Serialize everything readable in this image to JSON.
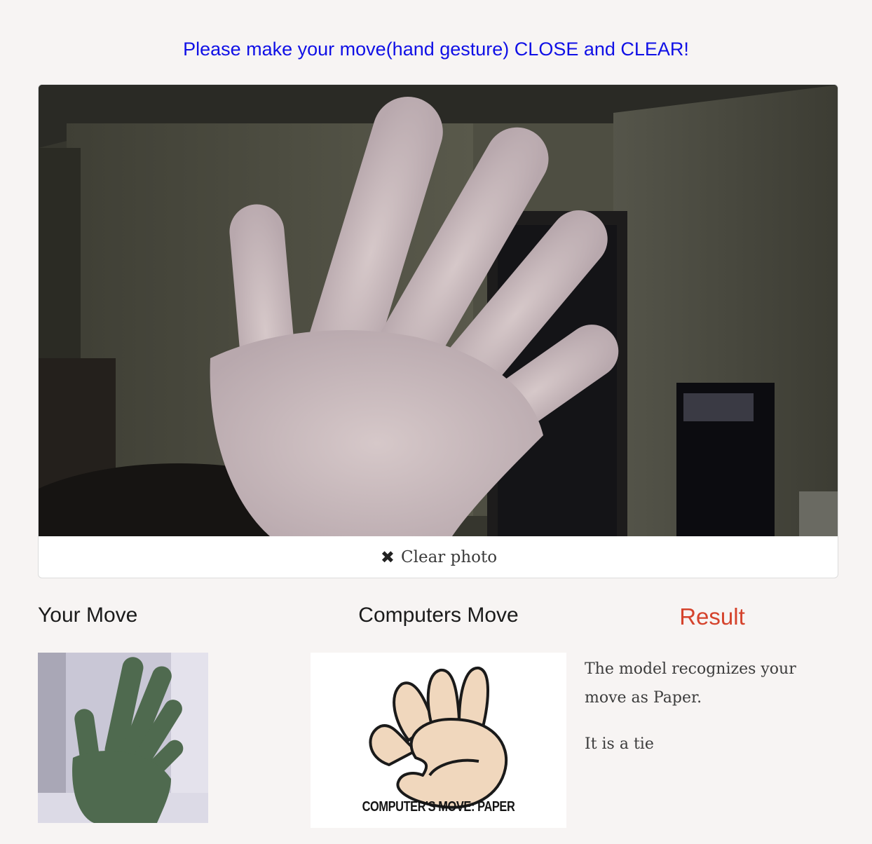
{
  "instruction": "Please make your move(hand gesture) CLOSE and CLEAR!",
  "camera": {
    "clear_label": "Clear photo",
    "clear_icon": "close-icon"
  },
  "your_move": {
    "heading": "Your Move"
  },
  "computer_move": {
    "heading": "Computers Move",
    "caption": "COMPUTER'S MOVE: PAPER"
  },
  "result": {
    "heading": "Result",
    "recognition": "The model recognizes your move as Paper.",
    "outcome": "It is a tie"
  },
  "colors": {
    "instruction": "#1010e6",
    "result_heading": "#d5432c",
    "background": "#f7f4f3"
  }
}
